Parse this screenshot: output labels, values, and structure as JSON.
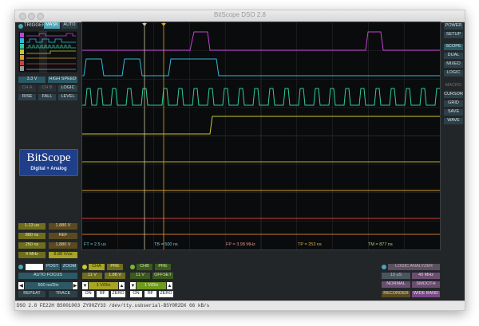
{
  "window": {
    "title": "BitScope DSO 2.8"
  },
  "trigger_panel": {
    "trigger_label": "TRIGGER",
    "mask_label": "MASK",
    "auto_label": "AUTO",
    "voltage": "3.3 V",
    "high_speed": "HIGH SPEED",
    "ch_a": "CH A",
    "ch_b": "CH B",
    "logic": "LOGIC",
    "rise": "RISE",
    "fall": "FALL",
    "level": "LEVEL"
  },
  "logo": {
    "brand": "BitScope",
    "tagline": "Digital + Analog"
  },
  "meas_panel": [
    [
      "1.13 us",
      "1.880 V"
    ],
    [
      "880 ns",
      "REF"
    ],
    [
      "250 ns",
      "1.880 V"
    ],
    [
      "4 MHz",
      "8.88 V/us"
    ]
  ],
  "right_panel": {
    "power": "POWER",
    "setup": "SETUP",
    "scope": "SCOPE",
    "dual": "DUAL",
    "mixed": "MIXED",
    "logic": "LOGIC",
    "macro": "MACRO",
    "cursor": "CURSOR",
    "grid": "GRID",
    "save": "SAVE",
    "wave": "WAVE"
  },
  "readouts": {
    "ft": "FT = 2.5 us",
    "tb": "TB = 500 ns",
    "fp": "FP = 3.98 MHz",
    "tp": "TP = 253 ns",
    "tm": "TM = 877 ns"
  },
  "timebase": {
    "post": "POST",
    "zoom": "ZOOM",
    "auto_focus": "AUTO FOCUS",
    "value": "500 ns/Div",
    "repeat": "REPEAT",
    "trace": "TRACE"
  },
  "channel_a": {
    "name": "CHA",
    "pre": "PRE",
    "range": "11 V",
    "offset": "1.88 V",
    "vdiv": "1 V/Div",
    "on": "ON",
    "rf": "RF",
    "zero": "ZERO"
  },
  "channel_b": {
    "name": "CHB",
    "pre": "PRE",
    "range": "11 V",
    "offset": "OFFSET",
    "vdiv": "1 V/Div",
    "on": "ON",
    "rf": "RF",
    "zero": "ZERO"
  },
  "analyzer": {
    "logic_analyzer": "LOGIC ANALYZER",
    "rate_a": "10 uS",
    "rate_b": "40 MHz",
    "normal": "NORMAL",
    "smooth": "SMOOTH",
    "recorder": "RECORDER",
    "wide_band": "WIDE BAND"
  },
  "status": {
    "text": "DSO 2.8 FE22H BS001003 ZY90ZY33 /dev/tty.usbserial-BSY0R2DX 66 kB/s"
  },
  "colors": {
    "magenta": "#c640d8",
    "cyan": "#2eb8dc",
    "green": "#2fcca0",
    "yellow": "#c8c830",
    "orange": "#d8a030",
    "red": "#d04040"
  }
}
